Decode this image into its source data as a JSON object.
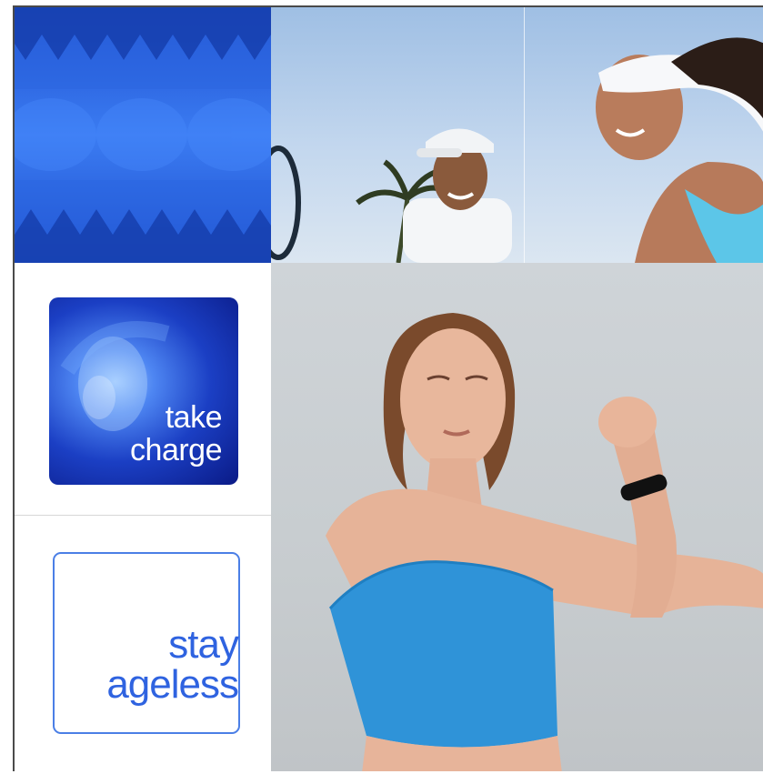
{
  "tiles": {
    "charge_card": {
      "line1": "take",
      "line2": "charge"
    },
    "ageless_card": {
      "line1": "stay",
      "line2": "ageless"
    }
  },
  "colors": {
    "brand_blue": "#2f63e0",
    "pattern_blue": "#2a6bea",
    "top_blue": "#4e93ff",
    "tank_top": "#2d8fd6"
  }
}
